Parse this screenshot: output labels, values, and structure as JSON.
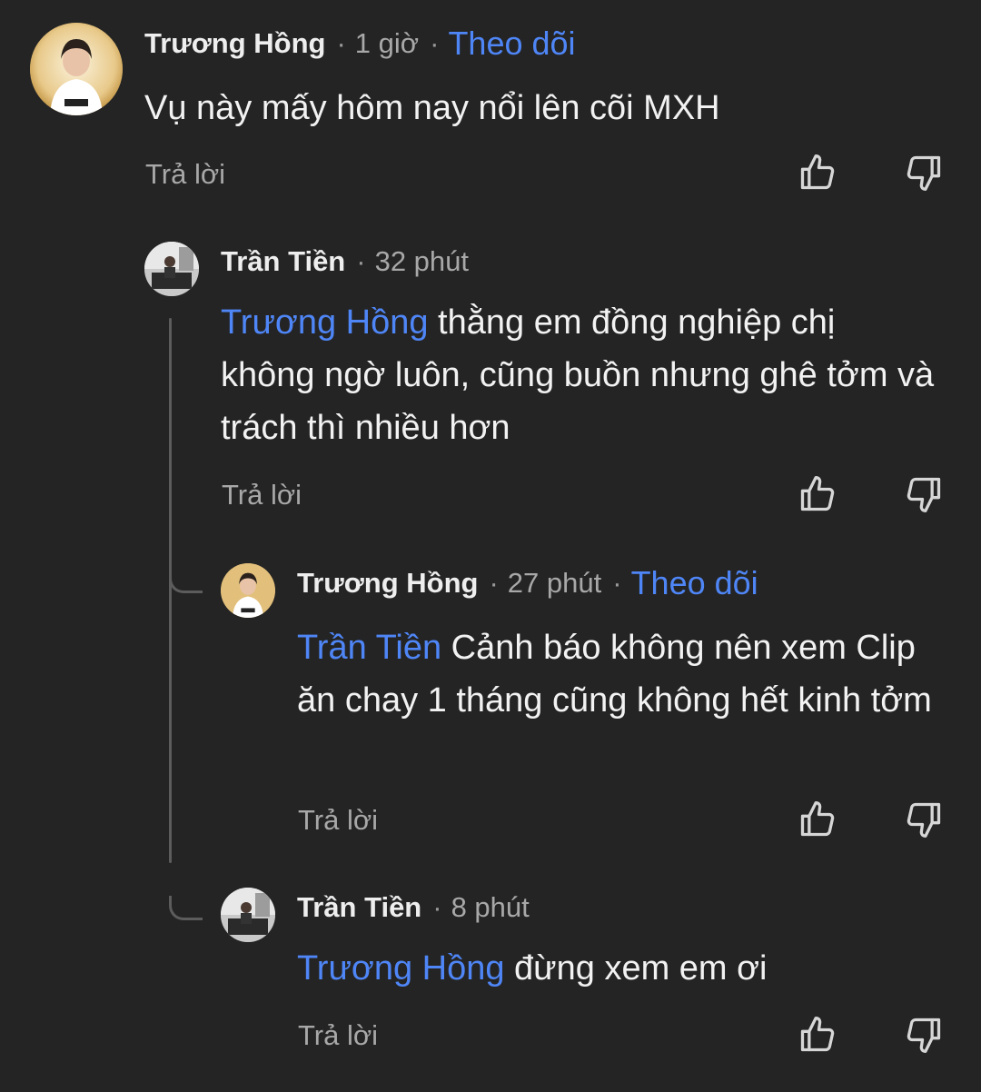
{
  "comments": [
    {
      "author": "Trương Hồng",
      "time": "1 giờ",
      "follow": "Theo dõi",
      "mention": "",
      "text": "Vụ này mấy hôm nay nổi lên cõi MXH",
      "reply": "Trả lời"
    },
    {
      "author": "Trần Tiền",
      "time": "32 phút",
      "follow": "",
      "mention": "Trương Hồng",
      "text": " thằng em đồng nghiệp chị không ngờ luôn, cũng buồn nhưng ghê tởm và trách thì nhiều hơn",
      "reply": "Trả lời"
    },
    {
      "author": "Trương Hồng",
      "time": "27 phút",
      "follow": "Theo dõi",
      "mention": "Trần Tiền",
      "text": " Cảnh báo không nên xem Clip ăn chay 1 tháng cũng không hết kinh tởm",
      "reply": "Trả lời"
    },
    {
      "author": "Trần Tiền",
      "time": "8 phút",
      "follow": "",
      "mention": "Trương Hồng",
      "text": " đừng xem em ơi",
      "reply": "Trả lời"
    }
  ]
}
